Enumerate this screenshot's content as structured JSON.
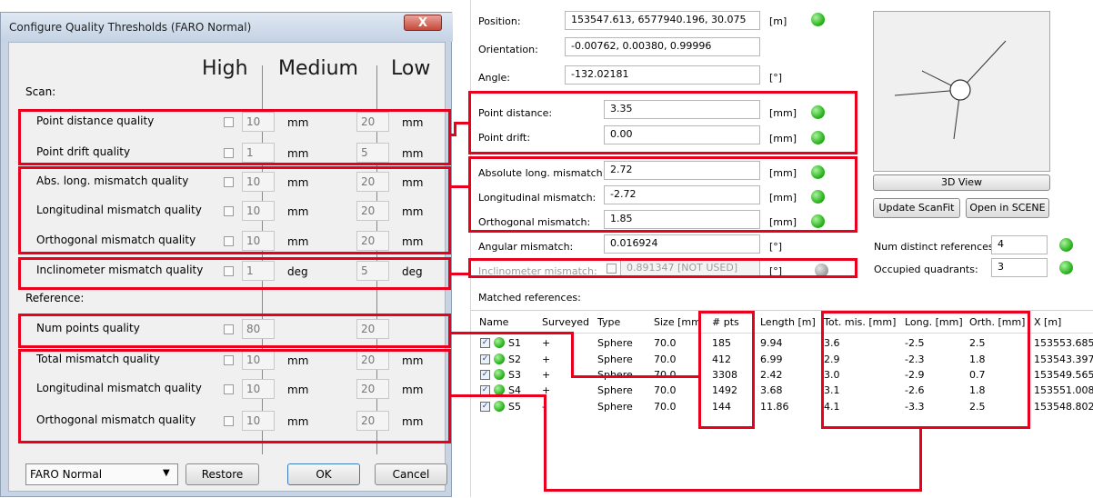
{
  "dialog": {
    "title": "Configure Quality Thresholds (FARO Normal)",
    "close_label": "X",
    "columns": [
      "High",
      "Medium",
      "Low"
    ],
    "scan_label": "Scan:",
    "reference_label": "Reference:",
    "scan_rows": [
      {
        "label": "Point distance quality",
        "high": "10",
        "low": "20",
        "unit": "mm"
      },
      {
        "label": "Point drift quality",
        "high": "1",
        "low": "5",
        "unit": "mm"
      },
      {
        "label": "Abs. long. mismatch quality",
        "high": "10",
        "low": "20",
        "unit": "mm"
      },
      {
        "label": "Longitudinal mismatch quality",
        "high": "10",
        "low": "20",
        "unit": "mm"
      },
      {
        "label": "Orthogonal mismatch quality",
        "high": "10",
        "low": "20",
        "unit": "mm"
      },
      {
        "label": "Inclinometer mismatch quality",
        "high": "1",
        "low": "5",
        "unit": "deg"
      }
    ],
    "reference_rows": [
      {
        "label": "Num points quality",
        "high": "80",
        "low": "20",
        "unit": ""
      },
      {
        "label": "Total mismatch quality",
        "high": "10",
        "low": "20",
        "unit": "mm"
      },
      {
        "label": "Longitudinal mismatch quality",
        "high": "10",
        "low": "20",
        "unit": "mm"
      },
      {
        "label": "Orthogonal mismatch quality",
        "high": "10",
        "low": "20",
        "unit": "mm"
      }
    ],
    "preset_value": "FARO Normal",
    "restore_label": "Restore",
    "ok_label": "OK",
    "cancel_label": "Cancel"
  },
  "panel": {
    "position": {
      "label": "Position:",
      "value": "153547.613, 6577940.196, 30.075",
      "unit": "[m]"
    },
    "orientation": {
      "label": "Orientation:",
      "value": "-0.00762, 0.00380, 0.99996"
    },
    "angle": {
      "label": "Angle:",
      "value": "-132.02181",
      "unit": "[°]"
    },
    "point_distance": {
      "label": "Point distance:",
      "value": "3.35",
      "unit": "[mm]"
    },
    "point_drift": {
      "label": "Point drift:",
      "value": "0.00",
      "unit": "[mm]"
    },
    "abs_long": {
      "label": "Absolute long. mismatch:",
      "value": "2.72",
      "unit": "[mm]"
    },
    "longitudinal": {
      "label": "Longitudinal mismatch:",
      "value": "-2.72",
      "unit": "[mm]"
    },
    "orthogonal": {
      "label": "Orthogonal mismatch:",
      "value": "1.85",
      "unit": "[mm]"
    },
    "angular": {
      "label": "Angular mismatch:",
      "value": "0.016924",
      "unit": "[°]"
    },
    "inclinometer": {
      "label": "Inclinometer mismatch:",
      "value": "0.891347 [NOT USED]",
      "unit": "[°]"
    },
    "view3d_label": "3D View",
    "update_label": "Update ScanFit",
    "open_label": "Open in SCENE",
    "num_refs": {
      "label": "Num distinct references:",
      "value": "4"
    },
    "quadrants": {
      "label": "Occupied quadrants:",
      "value": "3"
    },
    "matched_label": "Matched references:"
  },
  "table": {
    "headers": [
      "Name",
      "Surveyed",
      "Type",
      "Size [mm",
      "# pts",
      "Length [m]",
      "Tot. mis. [mm]",
      "Long. [mm]",
      "Orth. [mm]",
      "X [m]"
    ],
    "rows": [
      [
        "S1",
        "+",
        "Sphere",
        "70.0",
        "185",
        "9.94",
        "3.6",
        "-2.5",
        "2.5",
        "153553.685"
      ],
      [
        "S2",
        "+",
        "Sphere",
        "70.0",
        "412",
        "6.99",
        "2.9",
        "-2.3",
        "1.8",
        "153543.397"
      ],
      [
        "S3",
        "+",
        "Sphere",
        "70.0",
        "3308",
        "2.42",
        "3.0",
        "-2.9",
        "0.7",
        "153549.565"
      ],
      [
        "S4",
        "+",
        "Sphere",
        "70.0",
        "1492",
        "3.68",
        "3.1",
        "-2.6",
        "1.8",
        "153551.008"
      ],
      [
        "S5",
        "-",
        "Sphere",
        "70.0",
        "144",
        "11.86",
        "4.1",
        "-3.3",
        "2.5",
        "153548.802"
      ]
    ]
  },
  "colors": {
    "highlight": "#e8001c",
    "status_ok": "#27b01a",
    "status_off": "#a0a0a0"
  }
}
